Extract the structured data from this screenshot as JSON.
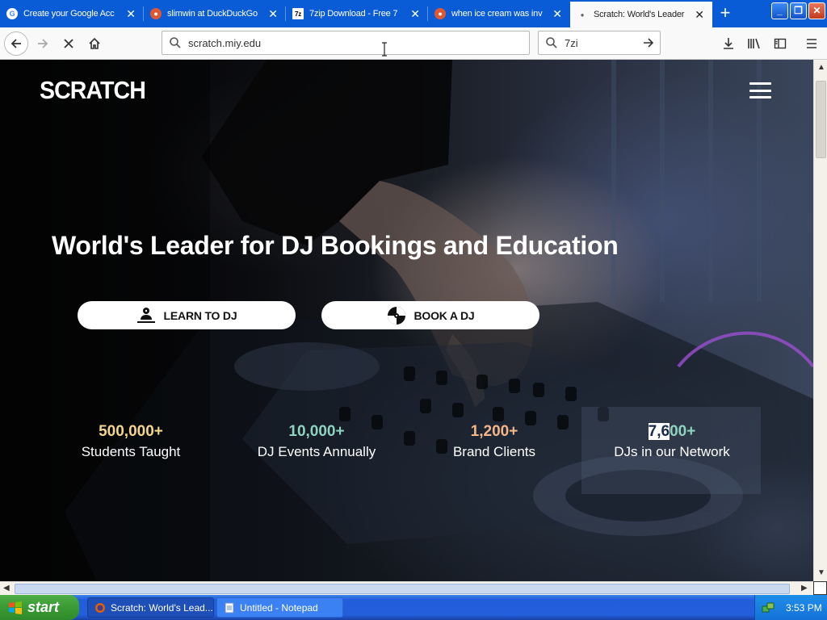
{
  "browser": {
    "tabs": [
      {
        "title": "Create your Google Acc",
        "favicon": "google-icon",
        "active": false
      },
      {
        "title": "slimwin at DuckDuckGo",
        "favicon": "duckduckgo-icon",
        "active": false
      },
      {
        "title": "7zip Download - Free 7",
        "favicon": "7zip-icon",
        "active": false
      },
      {
        "title": "when ice cream was inv",
        "favicon": "duckduckgo-icon",
        "active": false
      },
      {
        "title": "Scratch: World's Leader",
        "favicon": "loading-dot-icon",
        "active": true
      }
    ],
    "new_tab_label": "+",
    "url": "scratch.miy.edu",
    "search_value": "7zi"
  },
  "page": {
    "logo": "SCRATCH",
    "headline": "World's Leader for DJ Bookings and Education",
    "buttons": {
      "learn": "LEARN TO DJ",
      "book": "BOOK A DJ"
    },
    "stats": [
      {
        "number": "500,000+",
        "label": "Students Taught",
        "color": "#f4d58d"
      },
      {
        "number": "10,000+",
        "label": "DJ Events Annually",
        "color": "#8fd3c0"
      },
      {
        "number": "1,200+",
        "label": "Brand Clients",
        "color": "#f3b58a"
      },
      {
        "number_selected": "7,6",
        "number_rest": "00+",
        "label": "DJs in our Network",
        "color": "#8fd3c0"
      }
    ]
  },
  "taskbar": {
    "start_label": "start",
    "tasks": [
      {
        "label": "Scratch: World's Lead...",
        "active": true
      },
      {
        "label": "Untitled - Notepad",
        "active": false
      }
    ],
    "clock": "3:53 PM"
  },
  "colors": {
    "tabbar": "#0a5bd6",
    "taskbar": "#245edb",
    "start": "#3a9a34"
  }
}
